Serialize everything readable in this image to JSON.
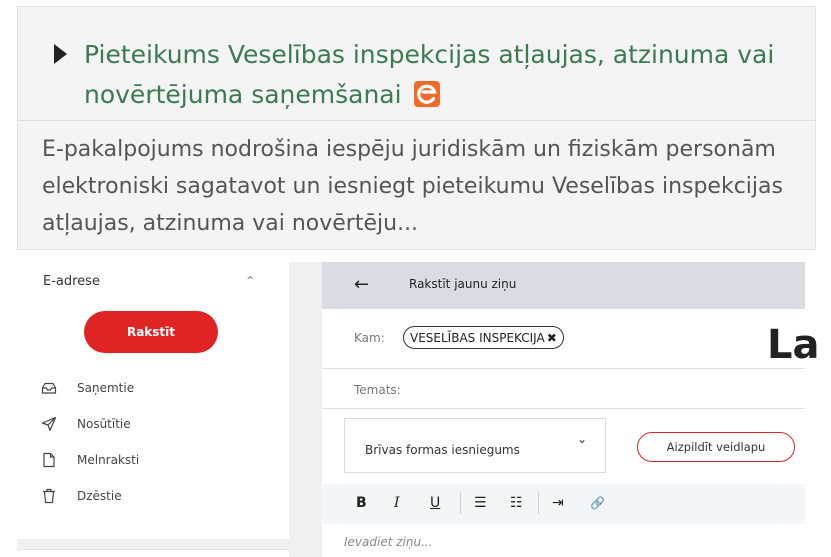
{
  "card": {
    "title": "Pieteikums Veselības inspekcijas atļaujas, atzinuma vai novērtējuma saņemšanai",
    "badge_icon": "e-service-icon",
    "description": "E-pakalpojums nodrošina iespēju juridiskām un fiziskām personām elektroniski sagatavot un iesniegt pieteikumu Veselības inspekcijas atļaujas, atzinuma vai novērtēju..."
  },
  "sidebar": {
    "title": "E-adrese",
    "write_label": "Rakstīt",
    "items": [
      {
        "label": "Saņemtie",
        "icon": "inbox-icon"
      },
      {
        "label": "Nosūtītie",
        "icon": "send-icon"
      },
      {
        "label": "Melnraksti",
        "icon": "draft-icon"
      },
      {
        "label": "Dzēstie",
        "icon": "trash-icon"
      }
    ]
  },
  "compose": {
    "title": "Rakstīt jaunu ziņu",
    "to_label": "Kam:",
    "recipient": "VESELĪBAS INSPEKCIJA",
    "subject_label": "Temats:",
    "form_select": "Brīvas formas iesniegums",
    "fill_form_label": "Aizpildīt veidlapu",
    "toolbar": {
      "bold": "B",
      "italic": "I",
      "underline": "U",
      "bullet_list": "☰",
      "numbered_list": "☷",
      "indent": "⇥",
      "link": "🔗"
    },
    "body_placeholder": "Ievadiet ziņu..."
  },
  "overlay_text": "La",
  "colors": {
    "accent_red": "#e02323",
    "title_green": "#3c7a52",
    "badge_orange": "#f26a2a",
    "header_gray": "#d9dde2"
  }
}
